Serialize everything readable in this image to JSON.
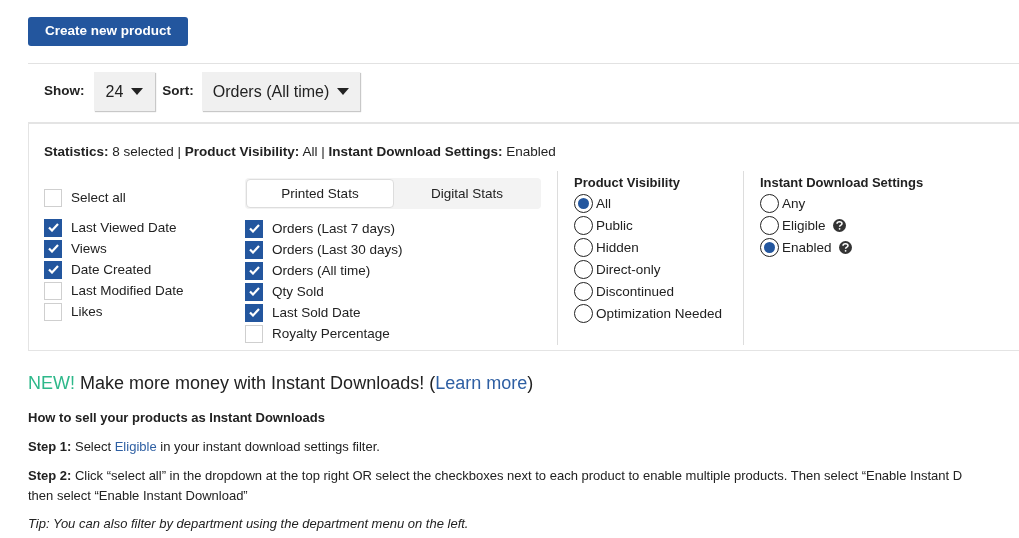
{
  "create_button": "Create new product",
  "toolbar": {
    "show_label": "Show:",
    "show_value": "24",
    "sort_label": "Sort:",
    "sort_value": "Orders (All time)"
  },
  "summary": "**Statistics:** 8 selected | **Product Visibility:** All | **Instant Download Settings:** Enabled",
  "select_all": {
    "label": "Select all",
    "checked": false
  },
  "general_stats": [
    {
      "label": "Last Viewed Date",
      "checked": true
    },
    {
      "label": "Views",
      "checked": true
    },
    {
      "label": "Date Created",
      "checked": true
    },
    {
      "label": "Last Modified Date",
      "checked": false
    },
    {
      "label": "Likes",
      "checked": false
    }
  ],
  "stat_tabs": [
    {
      "label": "Printed Stats",
      "selected": true
    },
    {
      "label": "Digital Stats",
      "selected": false
    }
  ],
  "printed_stats": [
    {
      "label": "Orders (Last 7 days)",
      "checked": true
    },
    {
      "label": "Orders (Last 30 days)",
      "checked": true
    },
    {
      "label": "Orders (All time)",
      "checked": true
    },
    {
      "label": "Qty Sold",
      "checked": true
    },
    {
      "label": "Last Sold Date",
      "checked": true
    },
    {
      "label": "Royalty Percentage",
      "checked": false
    }
  ],
  "product_visibility": {
    "title": "Product Visibility",
    "options": [
      {
        "label": "All",
        "selected": true,
        "help": false
      },
      {
        "label": "Public",
        "selected": false,
        "help": false
      },
      {
        "label": "Hidden",
        "selected": false,
        "help": false
      },
      {
        "label": "Direct-only",
        "selected": false,
        "help": false
      },
      {
        "label": "Discontinued",
        "selected": false,
        "help": false
      },
      {
        "label": "Optimization Needed",
        "selected": false,
        "help": false
      }
    ]
  },
  "instant_download": {
    "title": "Instant Download Settings",
    "options": [
      {
        "label": "Any",
        "selected": false,
        "help": false
      },
      {
        "label": "Eligible",
        "selected": false,
        "help": true
      },
      {
        "label": "Enabled",
        "selected": true,
        "help": true
      }
    ]
  },
  "promo": {
    "badge": "NEW!",
    "text": "Make more money with Instant Downloads! (",
    "link": "Learn more",
    "after": ")"
  },
  "howto_title": "How to sell your products as Instant Downloads",
  "steps": [
    {
      "label": "Step 1:",
      "lines": [
        {
          "before": " Select ",
          "link": "Eligible",
          "after": " in your instant download settings filter."
        }
      ]
    },
    {
      "label": "Step 2:",
      "lines": [
        {
          "before": " Click “select all” in the dropdown at the top right OR select the checkboxes next to each product to enable multiple products. Then select “Enable Instant D"
        },
        {
          "before": "then select “Enable Instant Download”"
        }
      ]
    }
  ],
  "tip": "Tip: You can also filter by department using the department menu on the left."
}
